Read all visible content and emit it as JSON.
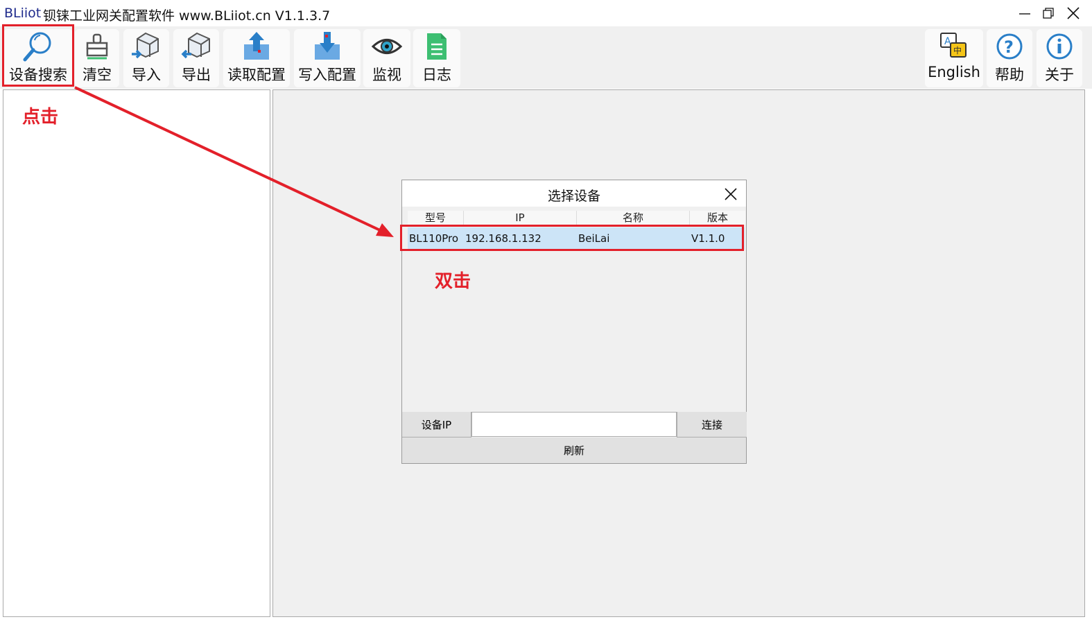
{
  "window": {
    "brand": "BLiiot",
    "title": "钡铼工业网关配置软件 www.BLiiot.cn V1.1.3.7"
  },
  "toolbar": {
    "items": [
      {
        "label": "设备搜索",
        "icon": "magnifier-icon"
      },
      {
        "label": "清空",
        "icon": "broom-icon"
      },
      {
        "label": "导入",
        "icon": "import-box-icon"
      },
      {
        "label": "导出",
        "icon": "export-box-icon"
      },
      {
        "label": "读取配置",
        "icon": "upload-icon"
      },
      {
        "label": "写入配置",
        "icon": "download-icon"
      },
      {
        "label": "监视",
        "icon": "eye-icon"
      },
      {
        "label": "日志",
        "icon": "log-document-icon"
      }
    ],
    "right_items": [
      {
        "label": "English",
        "icon": "language-icon"
      },
      {
        "label": "帮助",
        "icon": "help-icon"
      },
      {
        "label": "关于",
        "icon": "info-icon"
      }
    ]
  },
  "dialog": {
    "title": "选择设备",
    "columns": [
      "型号",
      "IP",
      "名称",
      "版本"
    ],
    "rows": [
      {
        "model": "BL110Pro",
        "ip": "192.168.1.132",
        "name": "BeiLai",
        "version": "V1.1.0"
      }
    ],
    "ip_label": "设备IP",
    "ip_value": "",
    "connect_label": "连接",
    "refresh_label": "刷新"
  },
  "annotations": {
    "click_text": "点击",
    "double_click_text": "双击",
    "color": "#e3202a"
  },
  "colors": {
    "accent_blue": "#4a90d9",
    "selected_row": "#cce4f7",
    "green": "#3dbf72"
  }
}
